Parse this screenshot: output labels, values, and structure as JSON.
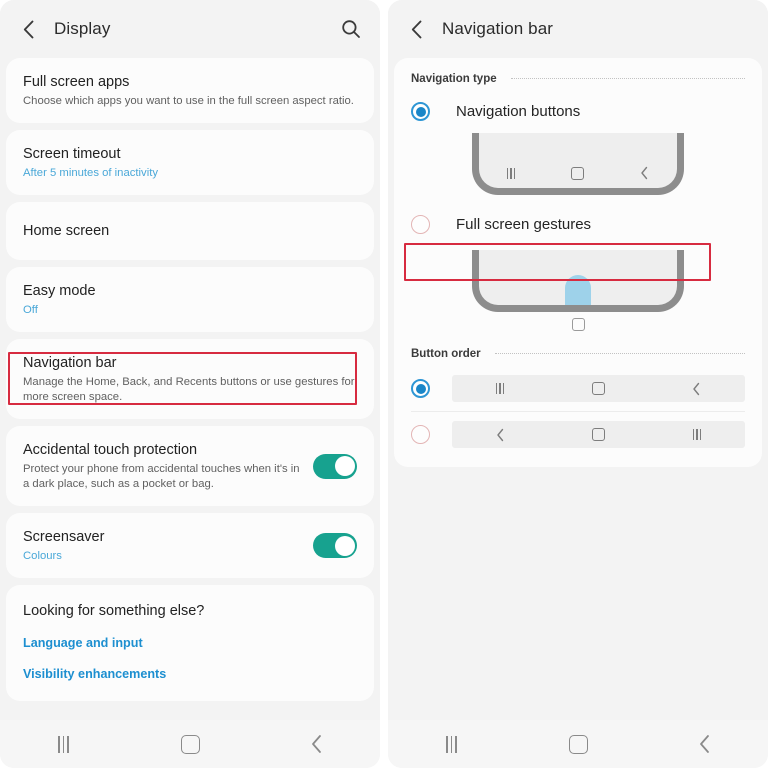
{
  "left_panel": {
    "header": {
      "back_icon": "back-chevron-icon",
      "title": "Display",
      "search_icon": "search-icon"
    },
    "items": [
      {
        "title": "Full screen apps",
        "subtitle": "Choose which apps you want to use in the full screen aspect ratio."
      },
      {
        "title": "Screen timeout",
        "subtitle": "After 5 minutes of inactivity"
      },
      {
        "title": "Home screen",
        "subtitle": ""
      },
      {
        "title": "Easy mode",
        "subtitle": "Off"
      },
      {
        "title": "Navigation bar",
        "subtitle": "Manage the Home, Back, and Recents buttons or use gestures for more screen space."
      },
      {
        "title": "Accidental touch protection",
        "subtitle": "Protect your phone from accidental touches when it's in a dark place, such as a pocket or bag.",
        "toggle": "on"
      },
      {
        "title": "Screensaver",
        "subtitle": "Colours",
        "toggle": "on"
      }
    ],
    "footer": {
      "heading": "Looking for something else?",
      "links": [
        "Language and input",
        "Visibility enhancements"
      ]
    },
    "nav": {
      "recents": "recents-icon",
      "home": "home-icon",
      "back": "back-icon"
    }
  },
  "right_panel": {
    "header": {
      "back_icon": "back-chevron-icon",
      "title": "Navigation bar"
    },
    "sections": [
      {
        "label": "Navigation type"
      },
      {
        "label": "Button order"
      }
    ],
    "navigation_type": {
      "options": [
        {
          "label": "Navigation buttons",
          "selected": true
        },
        {
          "label": "Full screen gestures",
          "selected": false
        }
      ]
    },
    "button_order": {
      "options": [
        {
          "order": [
            "recents",
            "home",
            "back"
          ],
          "selected": true
        },
        {
          "order": [
            "back",
            "home",
            "recents"
          ],
          "selected": false
        }
      ]
    },
    "nav": {
      "recents": "recents-icon",
      "home": "home-icon",
      "back": "back-icon"
    }
  },
  "annotations": {
    "highlight_color": "#d72b40",
    "boxes": [
      {
        "target": "Navigation bar"
      },
      {
        "target": "Full screen gestures"
      }
    ]
  },
  "colors": {
    "toggle_on": "#17a28f",
    "radio_selected": "#1a86c8",
    "link": "#1d8fd0",
    "accent_sub": "#4aa8d8",
    "gesture_pill": "#9ed2ea"
  }
}
